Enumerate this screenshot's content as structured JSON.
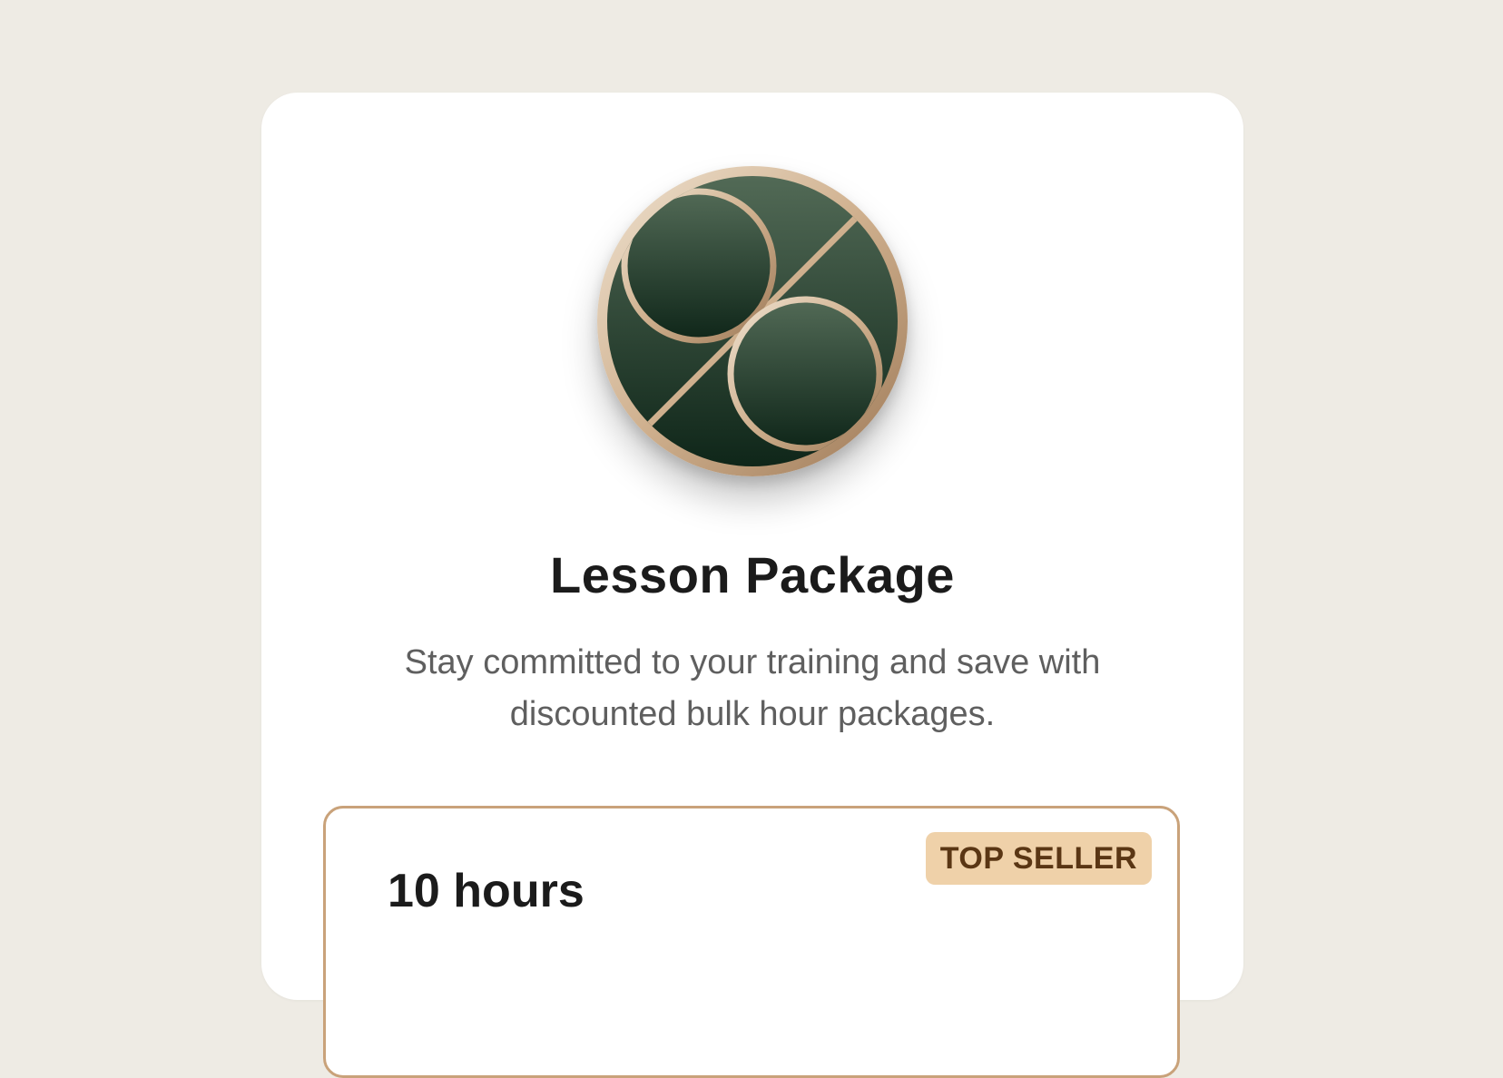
{
  "card": {
    "title": "Lesson Package",
    "description": "Stay committed to your training and save with discounted bulk hour packages."
  },
  "logo": {
    "icon": "double-circle-emblem-icon",
    "colors": {
      "ring": "#d9c0a3",
      "fill_top": "#526a56",
      "fill_bottom": "#0f2619"
    }
  },
  "package": {
    "hours_label": "10 hours",
    "badge": "TOP SELLER",
    "colors": {
      "border": "#c9a27a",
      "badge_bg": "#efd1a9",
      "badge_text": "#5a3614"
    }
  }
}
